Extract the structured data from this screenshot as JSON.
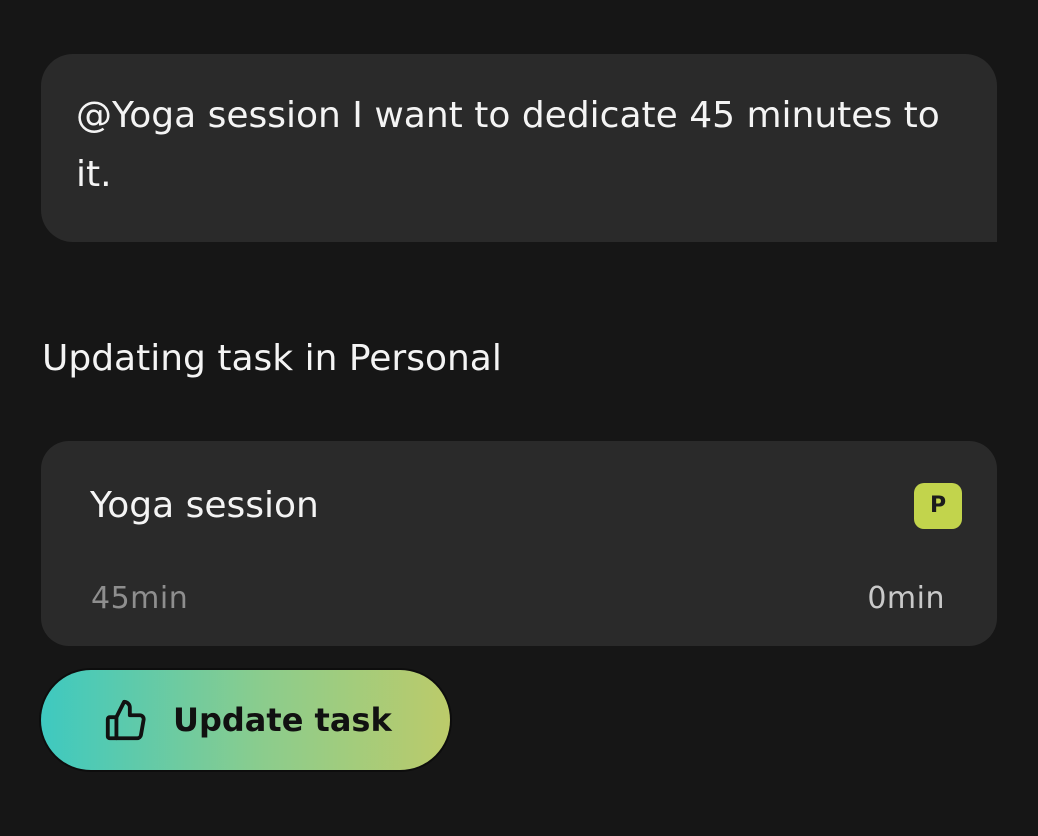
{
  "conversation": {
    "user_message": "@Yoga session I want to dedicate 45 minutes to it.",
    "status_text": "Updating task in Personal"
  },
  "task": {
    "title": "Yoga session",
    "category_badge": "P",
    "estimated_time": "45min",
    "tracked_time": "0min"
  },
  "actions": {
    "update_label": "Update task",
    "update_icon": "thumbs-up-icon"
  },
  "colors": {
    "background": "#161616",
    "card": "#2a2a2a",
    "badge": "#c2d44c",
    "button_gradient_start": "#3ec9c0",
    "button_gradient_end": "#bccb6a"
  }
}
